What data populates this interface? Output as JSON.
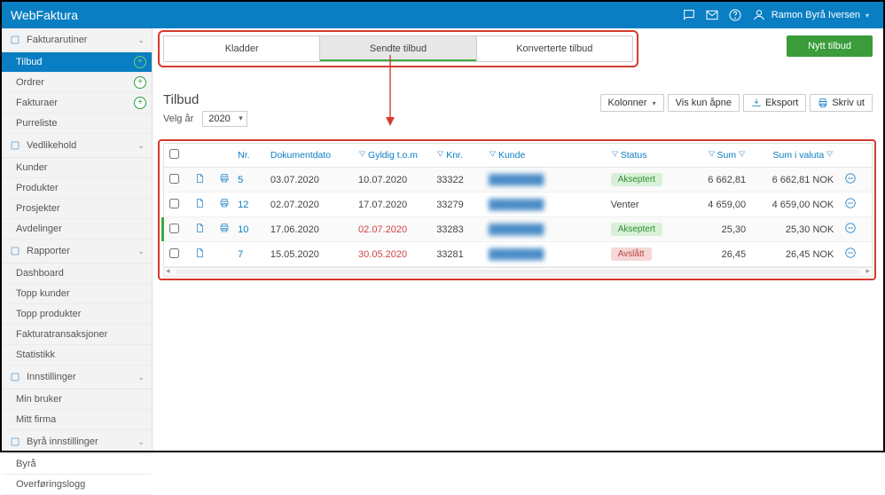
{
  "app": {
    "title": "WebFaktura",
    "user_name": "Ramon Byrå Iversen"
  },
  "sidebar": {
    "sections": [
      {
        "label": "Fakturarutiner",
        "icon": "invoice-icon",
        "items": [
          {
            "label": "Tilbud",
            "active": true,
            "has_add": true
          },
          {
            "label": "Ordrer",
            "has_add": true
          },
          {
            "label": "Fakturaer",
            "has_add": true
          },
          {
            "label": "Purreliste"
          }
        ]
      },
      {
        "label": "Vedlikehold",
        "icon": "wrench-icon",
        "items": [
          {
            "label": "Kunder"
          },
          {
            "label": "Produkter"
          },
          {
            "label": "Prosjekter"
          },
          {
            "label": "Avdelinger"
          }
        ]
      },
      {
        "label": "Rapporter",
        "icon": "chart-icon",
        "items": [
          {
            "label": "Dashboard"
          },
          {
            "label": "Topp kunder"
          },
          {
            "label": "Topp produkter"
          },
          {
            "label": "Fakturatransaksjoner"
          },
          {
            "label": "Statistikk"
          }
        ]
      },
      {
        "label": "Innstillinger",
        "icon": "gear-icon",
        "items": [
          {
            "label": "Min bruker"
          },
          {
            "label": "Mitt firma"
          }
        ]
      },
      {
        "label": "Byrå innstillinger",
        "icon": "gear-icon",
        "items": [
          {
            "label": "Byrå"
          },
          {
            "label": "Overføringslogg"
          }
        ]
      }
    ]
  },
  "main": {
    "tabs": [
      {
        "label": "Kladder"
      },
      {
        "label": "Sendte tilbud",
        "active": true
      },
      {
        "label": "Konverterte tilbud"
      }
    ],
    "new_button": "Nytt tilbud",
    "page_title": "Tilbud",
    "year_label": "Velg år",
    "year_value": "2020",
    "toolbar": {
      "columns": "Kolonner",
      "open_only": "Vis kun åpne",
      "export": "Eksport",
      "print": "Skriv ut"
    },
    "grid": {
      "headers": {
        "nr": "Nr.",
        "dokdato": "Dokumentdato",
        "gyldig": "Gyldig t.o.m",
        "knr": "Knr.",
        "kunde": "Kunde",
        "status": "Status",
        "sum": "Sum",
        "sumv": "Sum i valuta"
      },
      "rows": [
        {
          "nr": "5",
          "has_print": true,
          "dokdato": "03.07.2020",
          "gyldig": "10.07.2020",
          "gyldig_red": false,
          "knr": "33322",
          "kunde": "",
          "status": "Akseptert",
          "status_type": "acc",
          "sum": "6 662,81",
          "sumv": "6 662,81 NOK"
        },
        {
          "nr": "12",
          "has_print": true,
          "dokdato": "02.07.2020",
          "gyldig": "17.07.2020",
          "gyldig_red": false,
          "knr": "33279",
          "kunde": "",
          "status": "Venter",
          "status_type": "",
          "sum": "4 659,00",
          "sumv": "4 659,00 NOK"
        },
        {
          "nr": "10",
          "has_print": true,
          "green_bar": true,
          "dokdato": "17.06.2020",
          "gyldig": "02.07.2020",
          "gyldig_red": true,
          "knr": "33283",
          "kunde": "",
          "status": "Akseptert",
          "status_type": "acc",
          "sum": "25,30",
          "sumv": "25,30 NOK"
        },
        {
          "nr": "7",
          "has_print": false,
          "dokdato": "15.05.2020",
          "gyldig": "30.05.2020",
          "gyldig_red": true,
          "knr": "33281",
          "kunde": "",
          "status": "Avslått",
          "status_type": "rej",
          "sum": "26,45",
          "sumv": "26,45 NOK"
        }
      ]
    }
  }
}
